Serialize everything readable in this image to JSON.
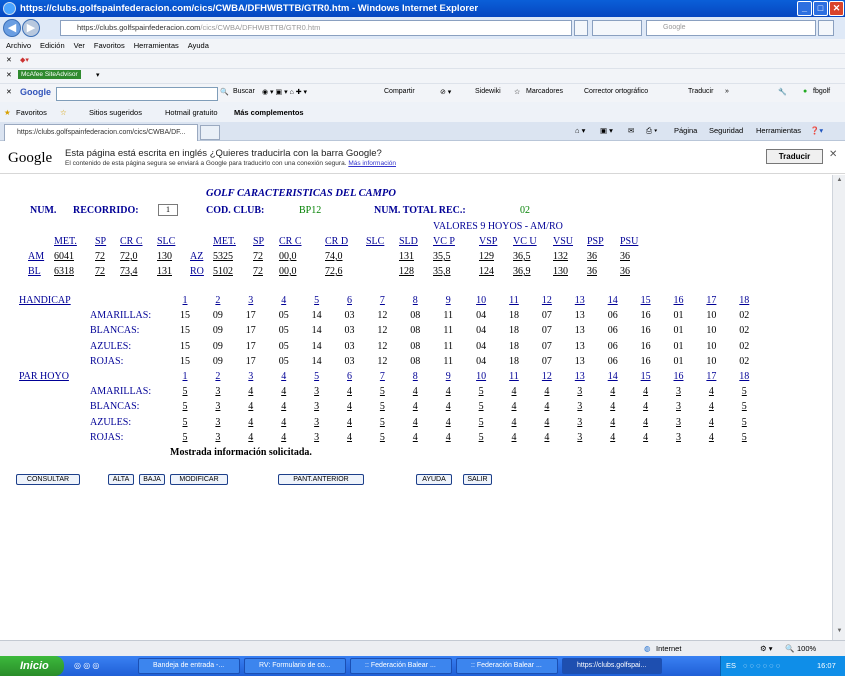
{
  "window": {
    "title": "https://clubs.golfspainfederacion.com/cics/CWBA/DFHWBTTB/GTR0.htm - Windows Internet Explorer",
    "address_bold": "https://clubs.golfspainfederacion.com",
    "address_dim": "/cics/CWBA/DFHWBTTB/GTR0.htm",
    "search_placeholder": "Google"
  },
  "menubar": [
    "Archivo",
    "Edición",
    "Ver",
    "Favoritos",
    "Herramientas",
    "Ayuda"
  ],
  "toolbars": {
    "mcafee": "McAfee SiteAdvisor",
    "google_label": "Google",
    "buscar": "Buscar",
    "compartir": "Compartir",
    "sidewiki": "Sidewiki",
    "marcadores": "Marcadores",
    "corrector": "Corrector ortográfico",
    "traducir": "Traducir",
    "user": "fbgolf"
  },
  "favorites": {
    "favoritos": "Favoritos",
    "sitios": "Sitios sugeridos",
    "hotmail": "Hotmail gratuito",
    "mas": "Más complementos"
  },
  "tab": {
    "title": "https://clubs.golfspainfederacion.com/cics/CWBA/DF..."
  },
  "commandbar": {
    "pagina": "Página",
    "seguridad": "Seguridad",
    "herramientas": "Herramientas"
  },
  "google_bar": {
    "logo": "Google",
    "message": "Esta página está escrita en inglés ¿Quieres traducirla con la barra Google?",
    "submessage": "El contenido de esta página segura se enviará a Google para traducirlo con una conexión segura.",
    "more_info": "Más información",
    "translate_button": "Traducir"
  },
  "page": {
    "title": "GOLF CARACTERISTICAS DEL CAMPO",
    "num_label": "NUM.",
    "recorrido_label": "RECORRIDO:",
    "recorrido_value": "1",
    "cod_club_label": "COD. CLUB:",
    "cod_club_value": "BP12",
    "num_total_label": "NUM. TOTAL REC.:",
    "num_total_value": "02",
    "valores_label": "VALORES 9 HOYOS - AM/RO",
    "tee_headers_left": [
      "MET.",
      "SP",
      "CR C",
      "SLC"
    ],
    "tee_headers_right": [
      "MET.",
      "SP",
      "CR C",
      "CR D",
      "SLC",
      "SLD",
      "VC P",
      "VSP",
      "VC U",
      "VSU",
      "PSP",
      "PSU"
    ],
    "tee_rows": [
      {
        "tee": "AM",
        "met": "6041",
        "sp": "72",
        "crc": "72,0",
        "slc": "130",
        "tee2": "AZ",
        "met2": "5325",
        "sp2": "72",
        "crc2": "00,0",
        "crd2": "74,0",
        "slc2": "",
        "sld2": "131",
        "vcp": "35,5",
        "vsp": "129",
        "vcu": "36,5",
        "vsu": "132",
        "psp": "36",
        "psu": "36"
      },
      {
        "tee": "BL",
        "met": "6318",
        "sp": "72",
        "crc": "73,4",
        "slc": "131",
        "tee2": "RO",
        "met2": "5102",
        "sp2": "72",
        "crc2": "00,0",
        "crd2": "72,6",
        "slc2": "",
        "sld2": "128",
        "vcp": "35,8",
        "vsp": "124",
        "vcu": "36,9",
        "vsu": "130",
        "psp": "36",
        "psu": "36"
      }
    ],
    "handicap_label": "HANDICAP",
    "par_label": "PAR HOYO",
    "holes": [
      "1",
      "2",
      "3",
      "4",
      "5",
      "6",
      "7",
      "8",
      "9",
      "10",
      "11",
      "12",
      "13",
      "14",
      "15",
      "16",
      "17",
      "18"
    ],
    "handicap_rows": [
      {
        "label": "AMARILLAS:",
        "values": [
          "15",
          "09",
          "17",
          "05",
          "14",
          "03",
          "12",
          "08",
          "11",
          "04",
          "18",
          "07",
          "13",
          "06",
          "16",
          "01",
          "10",
          "02"
        ]
      },
      {
        "label": "BLANCAS:",
        "values": [
          "15",
          "09",
          "17",
          "05",
          "14",
          "03",
          "12",
          "08",
          "11",
          "04",
          "18",
          "07",
          "13",
          "06",
          "16",
          "01",
          "10",
          "02"
        ]
      },
      {
        "label": "AZULES:",
        "values": [
          "15",
          "09",
          "17",
          "05",
          "14",
          "03",
          "12",
          "08",
          "11",
          "04",
          "18",
          "07",
          "13",
          "06",
          "16",
          "01",
          "10",
          "02"
        ]
      },
      {
        "label": "ROJAS:",
        "values": [
          "15",
          "09",
          "17",
          "05",
          "14",
          "03",
          "12",
          "08",
          "11",
          "04",
          "18",
          "07",
          "13",
          "06",
          "16",
          "01",
          "10",
          "02"
        ]
      }
    ],
    "par_rows": [
      {
        "label": "AMARILLAS:",
        "values": [
          "5",
          "3",
          "4",
          "4",
          "3",
          "4",
          "5",
          "4",
          "4",
          "5",
          "4",
          "4",
          "3",
          "4",
          "4",
          "3",
          "4",
          "5"
        ]
      },
      {
        "label": "BLANCAS:",
        "values": [
          "5",
          "3",
          "4",
          "4",
          "3",
          "4",
          "5",
          "4",
          "4",
          "5",
          "4",
          "4",
          "3",
          "4",
          "4",
          "3",
          "4",
          "5"
        ]
      },
      {
        "label": "AZULES:",
        "values": [
          "5",
          "3",
          "4",
          "4",
          "3",
          "4",
          "5",
          "4",
          "4",
          "5",
          "4",
          "4",
          "3",
          "4",
          "4",
          "3",
          "4",
          "5"
        ]
      },
      {
        "label": "ROJAS:",
        "values": [
          "5",
          "3",
          "4",
          "4",
          "3",
          "4",
          "5",
          "4",
          "4",
          "5",
          "4",
          "4",
          "3",
          "4",
          "4",
          "3",
          "4",
          "5"
        ]
      }
    ],
    "message": "Mostrada información solicitada.",
    "buttons": {
      "consultar": "CONSULTAR",
      "alta": "ALTA",
      "baja": "BAJA",
      "modificar": "MODIFICAR",
      "pant_anterior": "PANT.ANTERIOR",
      "ayuda": "AYUDA",
      "salir": "SALIR"
    }
  },
  "status": {
    "zone": "Internet",
    "zoom": "100%"
  },
  "taskbar": {
    "start": "Inicio",
    "tasks": [
      "Bandeja de entrada -...",
      "RV: Formulario de co...",
      ":: Federación Balear ...",
      ":: Federación Balear ...",
      "https://clubs.golfspai..."
    ],
    "lang": "ES",
    "clock": "16:07"
  },
  "colors": {
    "title_blue": "#000096",
    "value_green": "#008000"
  }
}
